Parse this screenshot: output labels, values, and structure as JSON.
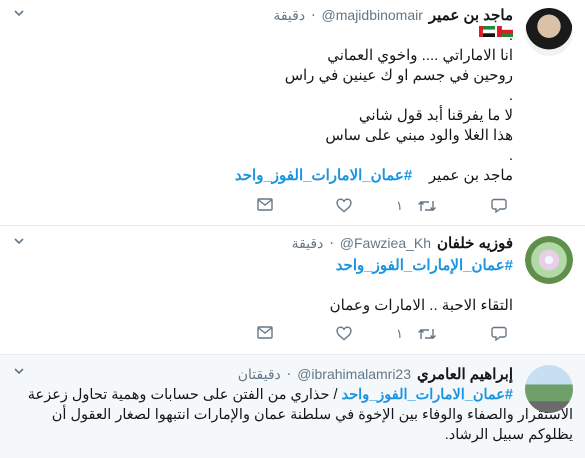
{
  "colors": {
    "accent": "#1b95e0",
    "muted": "#657786",
    "text": "#14171a",
    "divider": "#e6ecf0"
  },
  "tweets": [
    {
      "name": "ماجد بن عمير",
      "handle": "@majidbinomair",
      "time": "دقيقة",
      "flags": [
        "uae-flag",
        "oman-flag"
      ],
      "lines": [
        ".",
        "انا الاماراتي .... واخوي العماني",
        "روحين في جسم او ك عينين في راس",
        ".",
        "لا ما يفرقنا أبد قول شاني",
        "هذا الغلا والود مبني على ساس",
        "."
      ],
      "signature": "ماجد بن عمير",
      "hashtag": "#عمان_الامارات_الفوز_واحد",
      "retweets": "١",
      "icons": {
        "reply": "reply-icon",
        "retweet": "retweet-icon",
        "like": "heart-icon",
        "dm": "envelope-icon"
      }
    },
    {
      "name": "فوزيه خلفان",
      "handle": "@Fawziea_Kh",
      "time": "دقيقة",
      "hashtag": "#عمان_الإمارات_الفوز_واحد",
      "text": "التقاء الاحبة ..  الامارات وعمان",
      "retweets": "١"
    },
    {
      "name": "إبراهيم العامري",
      "handle": "@ibrahimalamri23",
      "time": "دقيقتان",
      "hashtag": "#عمان_الامارات_الفوز_واحد",
      "lines": [
        "/ حذاري من الفتن على حسابات وهمية تحاول زعزعة",
        "الاستقرار والصفاء والوفاء  بين الإخوة في سلطنة عمان والإمارات انتبهوا لصغار العقول أن",
        "يظلوكم سبيل الرشاد."
      ]
    }
  ]
}
